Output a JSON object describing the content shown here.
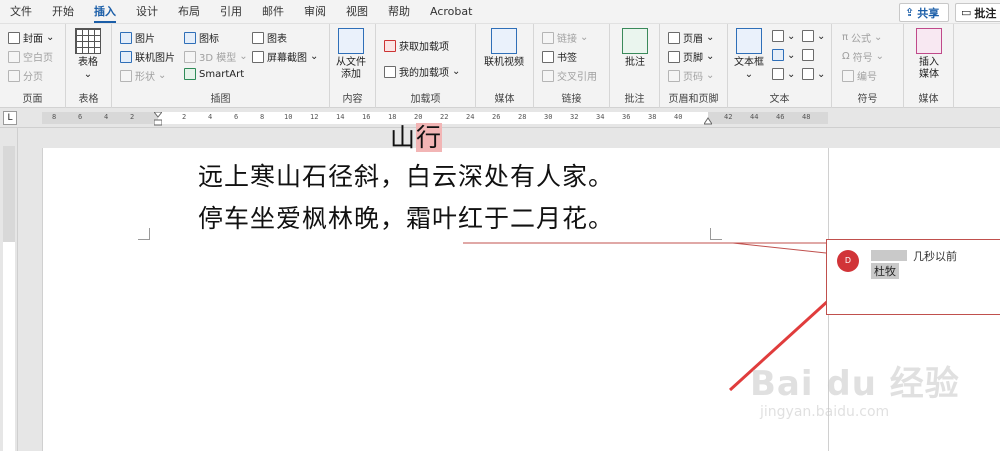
{
  "menu": {
    "tabs": [
      "文件",
      "开始",
      "插入",
      "设计",
      "布局",
      "引用",
      "邮件",
      "审阅",
      "视图",
      "帮助",
      "Acrobat"
    ],
    "active": "插入",
    "share_label": "共享",
    "comment_label": "批注"
  },
  "ribbon": {
    "pages": {
      "label": "页面",
      "cover": "封面",
      "blank": "空白页",
      "break": "分页"
    },
    "tables": {
      "label": "表格",
      "table": "表格"
    },
    "illustrations": {
      "label": "插图",
      "picture": "图片",
      "online_picture": "联机图片",
      "shapes": "形状",
      "icons": "图标",
      "model3d": "3D 模型",
      "smartart": "SmartArt",
      "chart": "图表",
      "screenshot": "屏幕截图"
    },
    "content": {
      "label": "内容",
      "from_file_1": "从文件",
      "from_file_2": "添加"
    },
    "addins": {
      "label": "加载项",
      "get": "获取加载项",
      "mine": "我的加载项"
    },
    "media": {
      "label": "媒体",
      "online_video": "联机视频"
    },
    "links": {
      "label": "链接",
      "link": "链接",
      "bookmark": "书签",
      "cross_ref": "交叉引用"
    },
    "comments": {
      "label": "批注",
      "comment": "批注"
    },
    "header_footer": {
      "label": "页眉和页脚",
      "header": "页眉",
      "footer": "页脚",
      "page_number": "页码"
    },
    "text": {
      "label": "文本",
      "textbox": "文本框"
    },
    "symbols": {
      "label": "符号",
      "equation": "公式",
      "symbol": "符号",
      "numbering": "编号"
    },
    "media2": {
      "label": "媒体",
      "insert_media_1": "插入",
      "insert_media_2": "媒体"
    }
  },
  "ruler": {
    "corner": "L",
    "ticks": [
      "8",
      "6",
      "4",
      "2",
      "2",
      "4",
      "6",
      "8",
      "10",
      "12",
      "14",
      "16",
      "18",
      "20",
      "22",
      "24",
      "26",
      "28",
      "30",
      "32",
      "34",
      "36",
      "38",
      "40",
      "42",
      "44",
      "46",
      "48"
    ]
  },
  "document": {
    "title_plain": "山",
    "title_highlight": "行",
    "line1": "远上寒山石径斜，白云深处有人家。",
    "line2": "停车坐爱枫林晚，霜叶红于二月花。"
  },
  "comment": {
    "avatar_initial": "D",
    "time": "几秒以前",
    "text": "杜牧"
  },
  "watermark": {
    "text": "Bai du 经验",
    "url": "jingyan.baidu.com"
  },
  "colors": {
    "accent": "#1b5ea8",
    "highlight": "#f2b5b5",
    "comment_border": "#c0504d",
    "arrow": "#e03c3c"
  }
}
